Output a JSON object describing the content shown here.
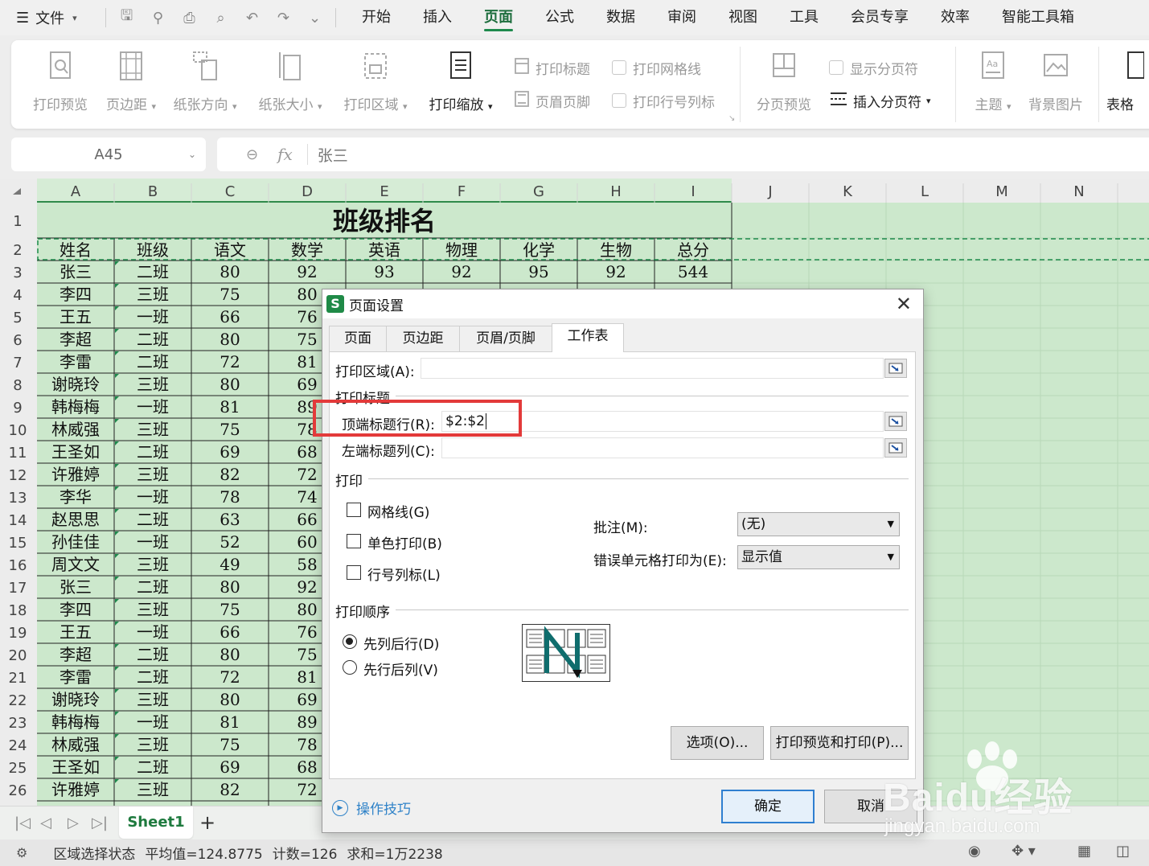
{
  "menubar": {
    "file_label": "文件",
    "tabs": [
      "开始",
      "插入",
      "页面",
      "公式",
      "数据",
      "审阅",
      "视图",
      "工具",
      "会员专享",
      "效率",
      "智能工具箱"
    ],
    "active_tab": "页面"
  },
  "ribbon": {
    "print_preview": "打印预览",
    "margins": "页边距",
    "orientation": "纸张方向",
    "paper_size": "纸张大小",
    "print_area": "打印区域",
    "print_scale": "打印缩放",
    "print_titles": "打印标题",
    "header_footer": "页眉页脚",
    "print_gridlines": "打印网格线",
    "print_headings": "打印行号列标",
    "page_break_preview": "分页预览",
    "show_page_breaks": "显示分页符",
    "insert_page_break": "插入分页符",
    "theme": "主题",
    "background": "背景图片",
    "table_style": "表格"
  },
  "formula_bar": {
    "cell_ref": "A45",
    "fx": "fx",
    "content": "张三"
  },
  "grid": {
    "columns": [
      "A",
      "B",
      "C",
      "D",
      "E",
      "F",
      "G",
      "H",
      "I",
      "J",
      "K",
      "L",
      "M",
      "N"
    ],
    "title": "班级排名",
    "headers": [
      "姓名",
      "班级",
      "语文",
      "数学",
      "英语",
      "物理",
      "化学",
      "生物",
      "总分"
    ],
    "rows": [
      [
        "张三",
        "二班",
        "80",
        "92",
        "93",
        "92",
        "95",
        "92",
        "544"
      ],
      [
        "李四",
        "三班",
        "75",
        "80"
      ],
      [
        "王五",
        "一班",
        "66",
        "76"
      ],
      [
        "李超",
        "二班",
        "80",
        "75"
      ],
      [
        "李雷",
        "二班",
        "72",
        "81"
      ],
      [
        "谢晓玲",
        "三班",
        "80",
        "69"
      ],
      [
        "韩梅梅",
        "一班",
        "81",
        "89"
      ],
      [
        "林威强",
        "三班",
        "75",
        "78"
      ],
      [
        "王圣如",
        "二班",
        "69",
        "68"
      ],
      [
        "许雅婷",
        "三班",
        "82",
        "72"
      ],
      [
        "李华",
        "一班",
        "78",
        "74"
      ],
      [
        "赵思思",
        "二班",
        "63",
        "66"
      ],
      [
        "孙佳佳",
        "一班",
        "52",
        "60"
      ],
      [
        "周文文",
        "三班",
        "49",
        "58"
      ],
      [
        "张三",
        "二班",
        "80",
        "92"
      ],
      [
        "李四",
        "三班",
        "75",
        "80"
      ],
      [
        "王五",
        "一班",
        "66",
        "76"
      ],
      [
        "李超",
        "二班",
        "80",
        "75"
      ],
      [
        "李雷",
        "二班",
        "72",
        "81"
      ],
      [
        "谢晓玲",
        "三班",
        "80",
        "69"
      ],
      [
        "韩梅梅",
        "一班",
        "81",
        "89"
      ],
      [
        "林威强",
        "三班",
        "75",
        "78"
      ],
      [
        "王圣如",
        "二班",
        "69",
        "68"
      ],
      [
        "许雅婷",
        "三班",
        "82",
        "72"
      ]
    ],
    "row_numbers": [
      "1",
      "2",
      "3",
      "4",
      "5",
      "6",
      "7",
      "8",
      "9",
      "10",
      "11",
      "12",
      "13",
      "14",
      "15",
      "16",
      "17",
      "18",
      "19",
      "20",
      "21",
      "22",
      "23",
      "24",
      "25",
      "26"
    ],
    "selection_color": "#cce8cc",
    "header_active_color": "#d6ecd6"
  },
  "sheet_tabs": {
    "active": "Sheet1",
    "add": "+"
  },
  "statusbar": {
    "mode": "区域选择状态",
    "average": "平均值=124.8775",
    "count": "计数=126",
    "sum": "求和=1万2238"
  },
  "dialog": {
    "title": "页面设置",
    "tabs": [
      "页面",
      "页边距",
      "页眉/页脚",
      "工作表"
    ],
    "active_tab": "工作表",
    "print_area_label": "打印区域(A):",
    "print_area_value": "",
    "print_titles_group": "打印标题",
    "top_rows_label": "顶端标题行(R):",
    "top_rows_value": "$2:$2",
    "left_cols_label": "左端标题列(C):",
    "left_cols_value": "",
    "print_group": "打印",
    "gridlines_label": "网格线(G)",
    "mono_label": "单色打印(B)",
    "headings_label": "行号列标(L)",
    "comments_label": "批注(M):",
    "comments_value": "(无)",
    "errors_label": "错误单元格打印为(E):",
    "errors_value": "显示值",
    "order_group": "打印顺序",
    "down_then_over": "先列后行(D)",
    "over_then_down": "先行后列(V)",
    "options_button": "选项(O)...",
    "preview_button": "打印预览和打印(P)...",
    "tips_link": "操作技巧",
    "ok_button": "确定",
    "cancel_button": "取消"
  },
  "watermark": {
    "brand": "Baidu经验",
    "url": "jingyan.baidu.com"
  }
}
